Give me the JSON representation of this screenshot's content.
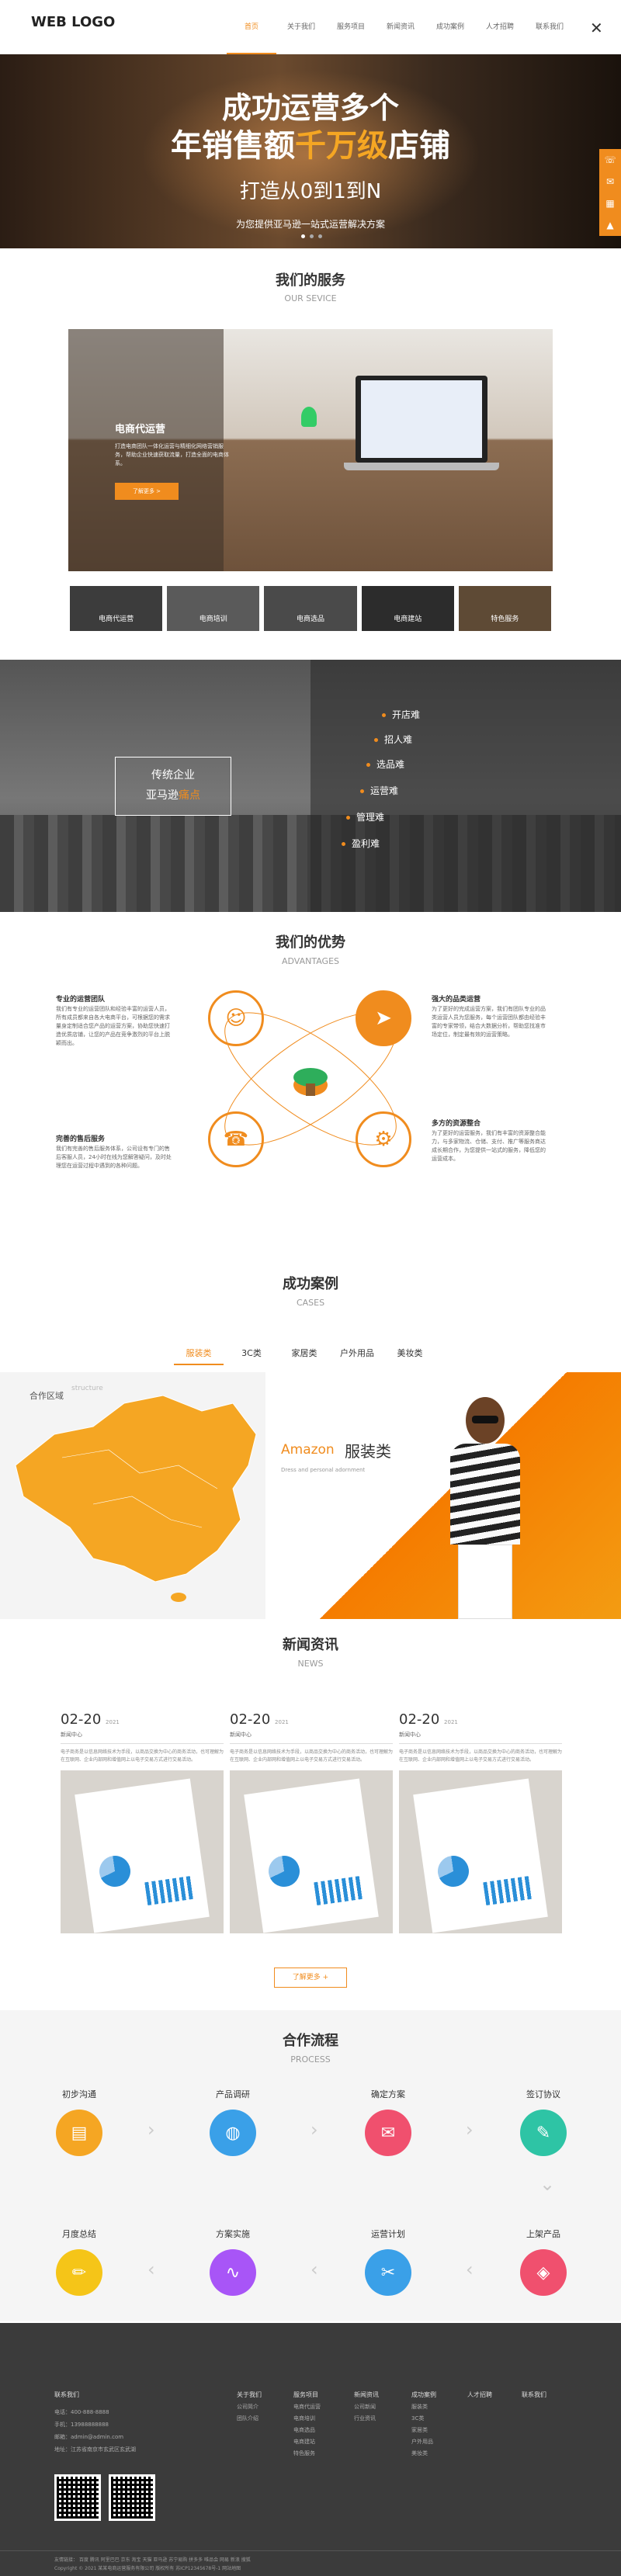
{
  "header": {
    "logo": "WEB LOGO",
    "nav": [
      "首页",
      "关于我们",
      "服务项目",
      "新闻资讯",
      "成功案例",
      "人才招聘",
      "联系我们"
    ]
  },
  "banner": {
    "line1": "成功运营多个",
    "line2_pre": "年销售额",
    "line2_hl": "千万级",
    "line2_post": "店铺",
    "line3": "打造从0到1到N",
    "line4": "为您提供亚马逊一站式运营解决方案"
  },
  "services": {
    "title": "我们的服务",
    "subtitle": "OUR SEVICE",
    "card_title": "电商代运营",
    "card_text": "打造电商团队一体化运营与精细化网络营销服务，帮助企业快速获取流量，打造全面的电商体系。",
    "card_button": "了解更多 >",
    "thumbs": [
      "电商代运营",
      "电商培训",
      "电商选品",
      "电商建站",
      "特色服务"
    ]
  },
  "pain": {
    "box_line1": "传统企业",
    "box_line2_pre": "亚马逊",
    "box_line2_hl": "痛点",
    "items": [
      "开店难",
      "招人难",
      "选品难",
      "运营难",
      "管理难",
      "盈利难"
    ]
  },
  "advantages": {
    "title": "我们的优势",
    "subtitle": "ADVANTAGES",
    "items": [
      {
        "title": "专业的运营团队",
        "text": "我们有专业的运营团队和经验丰富的运营人员，所有成员都来自各大电商平台，可根据您的需求量身定制适合您产品的运营方案，协助您快速打造优质店铺，让您的产品在竞争激烈的平台上脱颖而出。"
      },
      {
        "title": "强大的品类运营",
        "text": "为了更好的完成运营方案，我们有团队专业的品类运营人员为您服务，每个运营团队都由经验丰富的专家带领，结合大数据分析，帮助您找准市场定位，制定最有效的运营策略。"
      },
      {
        "title": "完善的售后服务",
        "text": "我们有完善的售后服务体系，公司设有专门的售后客服人员，24小时在线为您解答疑问，及时处理您在运营过程中遇到的各种问题。"
      },
      {
        "title": "多方的资源整合",
        "text": "为了更好的运营服务，我们有丰富的资源整合能力，与多家物流、仓储、支付、推广等服务商达成长期合作，为您提供一站式的服务，降低您的运营成本。"
      }
    ]
  },
  "cases": {
    "title": "成功案例",
    "subtitle": "CASES",
    "tabs": [
      "服装类",
      "3C类",
      "家居类",
      "户外用品",
      "美妆类"
    ],
    "map_label": "合作区域",
    "map_label_en": "structure",
    "amazon": "Amazon",
    "cat": "服装类",
    "cat_en": "Dress and personal adornment"
  },
  "news": {
    "title": "新闻资讯",
    "subtitle": "NEWS",
    "items": [
      {
        "date": "02-20",
        "year": "2021",
        "cat": "新闻中心",
        "text": "电子商务是以信息网络技术为手段，以商品交换为中心的商务活动，也可理解为在互联网、企业内部网和增值网上以电子交易方式进行交易活动。"
      },
      {
        "date": "02-20",
        "year": "2021",
        "cat": "新闻中心",
        "text": "电子商务是以信息网络技术为手段，以商品交换为中心的商务活动，也可理解为在互联网、企业内部网和增值网上以电子交易方式进行交易活动。"
      },
      {
        "date": "02-20",
        "year": "2021",
        "cat": "新闻中心",
        "text": "电子商务是以信息网络技术为手段，以商品交换为中心的商务活动，也可理解为在互联网、企业内部网和增值网上以电子交易方式进行交易活动。"
      }
    ],
    "more": "了解更多 +"
  },
  "process": {
    "title": "合作流程",
    "subtitle": "PROCESS",
    "steps": [
      "初步沟通",
      "产品调研",
      "确定方案",
      "签订协议",
      "上架产品",
      "运营计划",
      "方案实施",
      "月度总结"
    ]
  },
  "footer": {
    "contact_title": "联系我们",
    "phone": "电话：400-888-8888",
    "mobile": "手机：13988888888",
    "email": "邮箱：admin@admin.com",
    "address": "地址：江苏省南京市玄武区玄武湖",
    "cols": [
      {
        "h": "关于我们",
        "links": [
          "公司简介",
          "团队介绍"
        ]
      },
      {
        "h": "服务项目",
        "links": [
          "电商代运营",
          "电商培训",
          "电商选品",
          "电商建站",
          "特色服务"
        ]
      },
      {
        "h": "新闻资讯",
        "links": [
          "公司新闻",
          "行业资讯"
        ]
      },
      {
        "h": "成功案例",
        "links": [
          "服装类",
          "3C类",
          "家居类",
          "户外用品",
          "美妆类"
        ]
      },
      {
        "h": "人才招聘",
        "links": []
      },
      {
        "h": "联系我们",
        "links": []
      }
    ],
    "links": "友情链接： 百度 腾讯 阿里巴巴 京东 淘宝 天猫 亚马逊 苏宁易购 拼多多 唯品会 网易 新浪 搜狐",
    "copyright": "Copyright © 2021 某某电商运营服务有限公司 版权所有 苏ICP12345678号-1 网站地图"
  },
  "colors": {
    "accent": "#f08c1e",
    "header_bg": "#ffffff",
    "footer_bg": "#3b3b3b",
    "icon_colors": [
      "#f5a623",
      "#3aa0e8",
      "#f0506e",
      "#2ec4a5",
      "#f0506e",
      "#3aa0e8",
      "#a855f7",
      "#f5c518"
    ]
  }
}
